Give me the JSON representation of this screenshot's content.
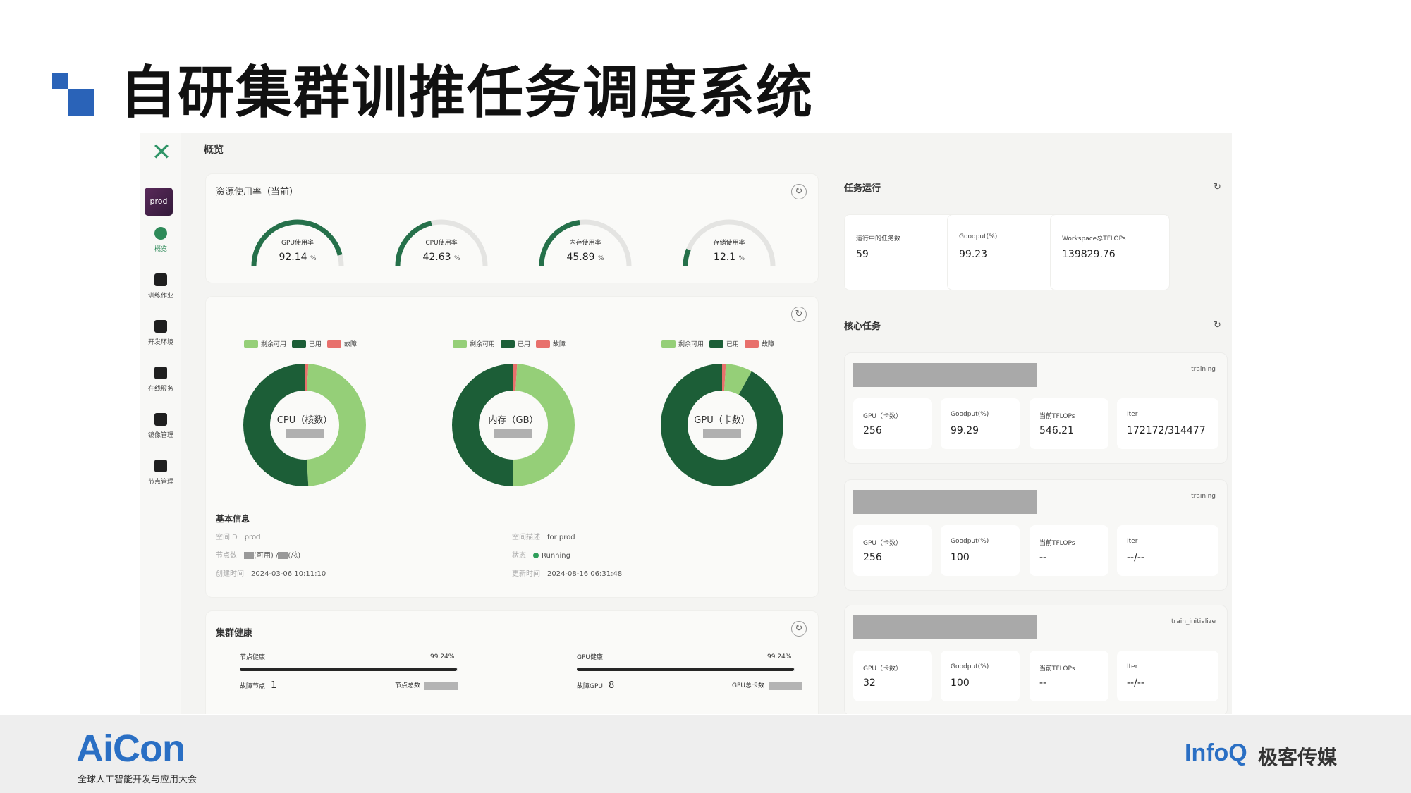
{
  "slide": {
    "title": "自研集群训推任务调度系统"
  },
  "sidebar": {
    "logo": "✕",
    "workspace_badge": "prod",
    "items": [
      {
        "label": "概览"
      },
      {
        "label": "训练作业"
      },
      {
        "label": "开发环境"
      },
      {
        "label": "在线服务"
      },
      {
        "label": "镜像管理"
      },
      {
        "label": "节点管理"
      }
    ]
  },
  "header": {
    "breadcrumb": "概览"
  },
  "resource": {
    "title": "资源使用率（当前）",
    "refresh": "↻",
    "gauges": [
      {
        "label": "GPU使用率",
        "value": "92.14",
        "unit": "%"
      },
      {
        "label": "CPU使用率",
        "value": "42.63",
        "unit": "%"
      },
      {
        "label": "内存使用率",
        "value": "45.89",
        "unit": "%"
      },
      {
        "label": "存储使用率",
        "value": "12.1",
        "unit": "%"
      }
    ]
  },
  "donuts": {
    "refresh": "↻",
    "legend": {
      "available": "剩余可用",
      "used": "已用",
      "fault": "故障"
    },
    "colors": {
      "available": "#95cf78",
      "used": "#1c5e37",
      "fault": "#e8706c"
    },
    "charts": [
      {
        "label": "CPU（核数）",
        "available": 0.48,
        "used": 0.51,
        "fault": 0.01
      },
      {
        "label": "内存（GB）",
        "available": 0.49,
        "used": 0.5,
        "fault": 0.01
      },
      {
        "label": "GPU（卡数）",
        "available": 0.07,
        "used": 0.92,
        "fault": 0.01
      }
    ]
  },
  "basic_info": {
    "title": "基本信息",
    "space_id_key": "空间ID",
    "space_id": "prod",
    "space_desc_key": "空间描述",
    "space_desc": "for prod",
    "nodes_key": "节点数",
    "nodes_available": "(可用) /",
    "nodes_total": "(总)",
    "status_key": "状态",
    "status": "Running",
    "created_key": "创建时间",
    "created": "2024-03-06 10:11:10",
    "updated_key": "更新时间",
    "updated": "2024-08-16 06:31:48"
  },
  "health": {
    "title": "集群健康",
    "refresh": "↻",
    "node_label": "节点健康",
    "node_pct": "99.24%",
    "node_value": 0.9924,
    "node_fault_label": "故障节点",
    "node_fault": "1",
    "node_total_label": "节点总数",
    "gpu_label": "GPU健康",
    "gpu_pct": "99.24%",
    "gpu_value": 0.9924,
    "gpu_fault_label": "故障GPU",
    "gpu_fault": "8",
    "gpu_total_label": "GPU总卡数"
  },
  "tasks": {
    "title": "任务运行",
    "refresh": "↻",
    "stats": [
      {
        "label": "运行中的任务数",
        "value": "59"
      },
      {
        "label": "Goodput(%)",
        "value": "99.23"
      },
      {
        "label": "Workspace总TFLOPs",
        "value": "139829.76"
      }
    ]
  },
  "core_tasks": {
    "title": "核心任务",
    "refresh": "↻",
    "items": [
      {
        "tag": "training",
        "gpu_label": "GPU（卡数）",
        "gpu": "256",
        "goodput_label": "Goodput(%)",
        "goodput": "99.29",
        "tflops_label": "当前TFLOPs",
        "tflops": "546.21",
        "iter_label": "Iter",
        "iter": "172172/314477"
      },
      {
        "tag": "training",
        "gpu_label": "GPU（卡数）",
        "gpu": "256",
        "goodput_label": "Goodput(%)",
        "goodput": "100",
        "tflops_label": "当前TFLOPs",
        "tflops": "--",
        "iter_label": "Iter",
        "iter": "--/--"
      },
      {
        "tag": "train_initialize",
        "gpu_label": "GPU（卡数）",
        "gpu": "32",
        "goodput_label": "Goodput(%)",
        "goodput": "100",
        "tflops_label": "当前TFLOPs",
        "tflops": "--",
        "iter_label": "Iter",
        "iter": "--/--"
      }
    ]
  },
  "footer": {
    "aicon": "AiCon",
    "aicon_sub": "全球人工智能开发与应用大会",
    "infoq": "InfoQ",
    "infoq_cn": "极客传媒"
  }
}
